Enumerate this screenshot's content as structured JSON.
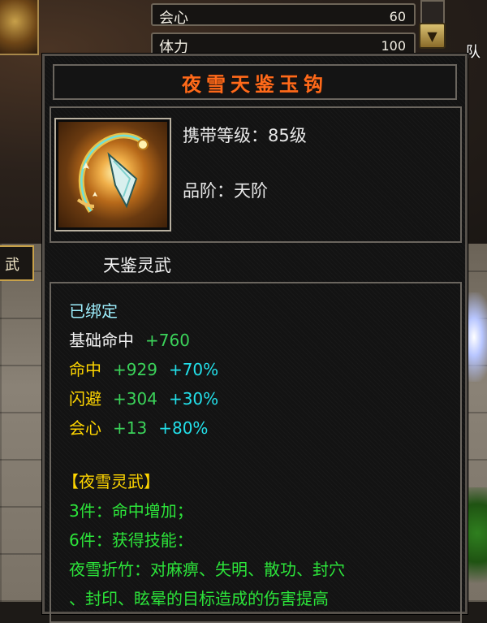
{
  "background_panel": {
    "stats": [
      {
        "name": "会心",
        "value": "60"
      },
      {
        "name": "体力",
        "value": "100"
      }
    ],
    "team_label": "队",
    "left_tab_label": "武",
    "scroll_button_icon": "chevron-down-icon"
  },
  "tooltip": {
    "item_name": "夜雪天鉴玉钩",
    "carry_level": "携带等级：85级",
    "grade": "品阶：天阶",
    "category": "天鉴灵武",
    "bind_status": "已绑定",
    "attributes": [
      {
        "name": "基础命中",
        "base": "+760",
        "bonus": "",
        "color": "white"
      },
      {
        "name": "命中",
        "base": "+929",
        "bonus": "+70%",
        "color": "yellow"
      },
      {
        "name": "闪避",
        "base": "+304",
        "bonus": "+30%",
        "color": "yellow"
      },
      {
        "name": "会心",
        "base": "+13",
        "bonus": "+80%",
        "color": "yellow"
      }
    ],
    "set": {
      "name": "【夜雪灵武】",
      "bonuses": [
        "3件：命中增加；",
        "6件：获得技能：",
        "夜雪折竹：对麻痹、失明、散功、封穴",
        "、封印、眩晕的目标造成的伤害提高"
      ]
    }
  },
  "colors": {
    "title": "#ff6a1a",
    "bind": "#9ef0ff",
    "base_attr": "#f2f2f2",
    "attr": "#ffd600",
    "base_value": "#3bd35a",
    "bonus_value": "#22e0ea",
    "set_text": "#2ce43a"
  }
}
